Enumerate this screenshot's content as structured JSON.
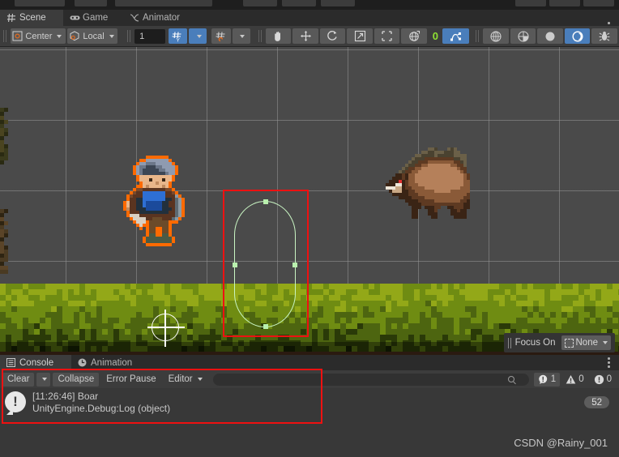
{
  "window": {
    "background_color": "#383838",
    "panel_color": "#3c3c3c",
    "tabbar_color": "#2b2b2b",
    "accent_blue": "#4a7ebb",
    "accent_green": "#8fe033",
    "highlight_red": "#ee1111",
    "selection_orange": "#ff6a00"
  },
  "tabs": {
    "items": [
      {
        "label": "Scene",
        "icon": "grid-icon",
        "active": true
      },
      {
        "label": "Game",
        "icon": "gamepad-icon",
        "active": false
      },
      {
        "label": "Animator",
        "icon": "animator-icon",
        "active": false
      }
    ],
    "overflow_menu": "kebab-menu-icon"
  },
  "scene_toolbar": {
    "pivot_mode": {
      "label": "Center",
      "icon": "pivot-center-icon"
    },
    "handle_space": {
      "label": "Local",
      "icon": "handle-local-icon"
    },
    "snap_value": "1",
    "grid_axis_button": {
      "icon": "grid-y-icon",
      "selected": true
    },
    "grid_snap_button": {
      "icon": "grid-snap-icon",
      "selected": false
    },
    "tools": [
      {
        "name": "hand-tool",
        "icon": "hand-icon",
        "selected": false
      },
      {
        "name": "move-tool",
        "icon": "move-arrows-icon",
        "selected": false
      },
      {
        "name": "rotate-tool",
        "icon": "rotate-icon",
        "selected": false
      },
      {
        "name": "scale-tool",
        "icon": "scale-icon",
        "selected": false
      },
      {
        "name": "rect-tool",
        "icon": "rect-transform-icon",
        "selected": false
      },
      {
        "name": "transform-tool",
        "icon": "transform-icon",
        "selected": false
      }
    ],
    "custom_tool_count": "0",
    "custom_editor_tool": {
      "icon": "custom-tool-icon",
      "selected": true
    },
    "view_options": [
      {
        "name": "draw-mode",
        "icon": "shaded-globe-icon",
        "selected": false
      },
      {
        "name": "2d-toggle",
        "icon": "globe-half-icon",
        "selected": false
      },
      {
        "name": "lighting-toggle",
        "icon": "sun-icon",
        "selected": false
      },
      {
        "name": "audio-toggle",
        "icon": "moon-icon",
        "selected": true
      },
      {
        "name": "effects-toggle",
        "icon": "bug-icon",
        "selected": false
      }
    ]
  },
  "scene_view": {
    "grid_spacing_px": 87,
    "sky_color": "#4a4a4a",
    "ground_colors": [
      "#93a818",
      "#6f8c12",
      "#4d6510",
      "#2a3a08",
      "#151f04"
    ],
    "focus_bar": {
      "label": "Focus On",
      "dropdown_value": "None",
      "dropdown_icon": "dashed-box-icon",
      "caret": "chevron-down-icon"
    },
    "objects": [
      {
        "name": "player-sprite",
        "selected": true,
        "outline_color": "#ff6a00"
      },
      {
        "name": "boar-sprite",
        "selected": false
      },
      {
        "name": "capsule-collider-gizmo",
        "color": "#c9f5c3"
      },
      {
        "name": "move-gizmo",
        "color": "#ffffff"
      }
    ]
  },
  "bottom_tabs": {
    "items": [
      {
        "label": "Console",
        "icon": "console-icon",
        "active": true
      },
      {
        "label": "Animation",
        "icon": "clock-icon",
        "active": false
      }
    ],
    "overflow_menu": "kebab-menu-icon"
  },
  "console": {
    "clear_label": "Clear",
    "clear_caret": "chevron-down-icon",
    "collapse_label": "Collapse",
    "error_pause_label": "Error Pause",
    "editor_label": "Editor",
    "editor_caret": "chevron-down-icon",
    "search_placeholder": "",
    "search_value": "",
    "search_icon": "search-icon",
    "counters": [
      {
        "name": "log-count",
        "icon": "log-icon",
        "value": "1",
        "active": true
      },
      {
        "name": "warning-count",
        "icon": "warning-icon",
        "value": "0",
        "active": false
      },
      {
        "name": "error-count",
        "icon": "error-icon",
        "value": "0",
        "active": false
      }
    ],
    "messages": [
      {
        "icon": "log-message-icon",
        "line1": "[11:26:46] Boar",
        "line2": "UnityEngine.Debug:Log (object)",
        "badge": "52"
      }
    ]
  },
  "watermark": {
    "text": "CSDN @Rainy_001"
  }
}
